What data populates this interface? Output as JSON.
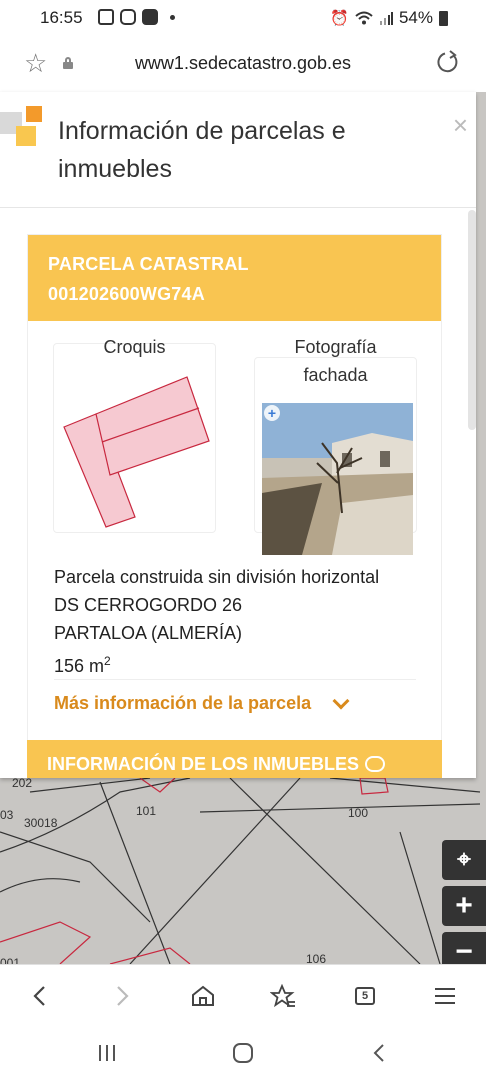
{
  "status_bar": {
    "time": "16:55",
    "battery": "54%"
  },
  "browser": {
    "url": "www1.sedecatastro.gob.es",
    "tabs_count": "5"
  },
  "panel": {
    "title": "Información de parcelas e inmuebles",
    "close_symbol": "×",
    "parcel": {
      "heading": "PARCELA CATASTRAL",
      "reference": "001202600WG74A",
      "croquis_label": "Croquis",
      "photo_label_line1": "Fotografía",
      "photo_label_line2": "fachada",
      "type": "Parcela construida sin división horizontal",
      "address": "DS CERROGORDO 26",
      "municipality": "PARTALOA (ALMERÍA)",
      "area_value": "156 m",
      "area_unit_sup": "2",
      "more_info": "Más información de la parcela"
    },
    "inmuebles_heading": "INFORMACIÓN DE LOS INMUEBLES"
  },
  "map": {
    "labels": [
      "101",
      "100",
      "106",
      "03",
      "30018",
      "202",
      "001"
    ]
  },
  "colors": {
    "accent": "#f9c551",
    "link": "#d98a1c",
    "parcel_fill": "#f6c9d1",
    "parcel_stroke": "#c8283f",
    "map_bg": "#c8c6c3"
  }
}
